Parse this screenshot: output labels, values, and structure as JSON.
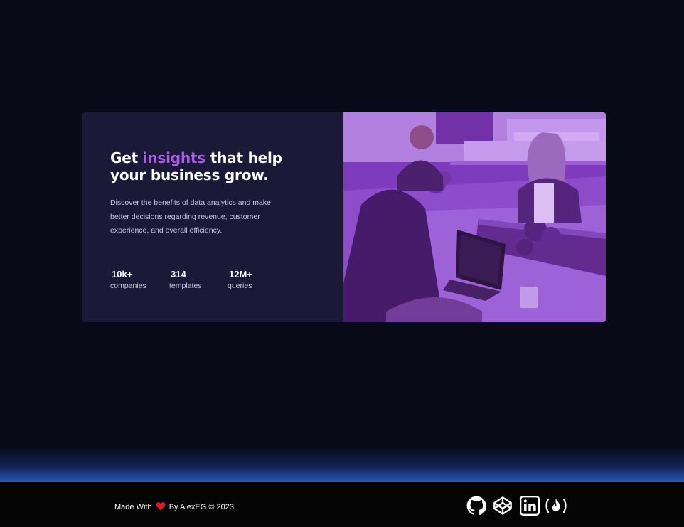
{
  "hero": {
    "headline_start": "Get ",
    "headline_accent": "insights",
    "headline_end": " that help your business grow.",
    "description": "Discover the benefits of data analytics and make better decisions regarding revenue, customer experience, and overall efficiency.",
    "stats": [
      {
        "value": "10k+",
        "label": "companies"
      },
      {
        "value": "314",
        "label": "templates"
      },
      {
        "value": "12M+",
        "label": "queries"
      }
    ],
    "accent_color": "#a95fe1",
    "card_color": "#1b1938",
    "photo_tint": "#8b3fd0"
  },
  "footer": {
    "made_with": "Made With",
    "by_text": "By AlexEG © 2023",
    "heart_icon": "heart-icon",
    "social_icons": [
      "github-icon",
      "codepen-icon",
      "linkedin-icon",
      "freecodecamp-icon"
    ]
  },
  "background_color": "#090a17",
  "glow_color": "#2b56b8"
}
